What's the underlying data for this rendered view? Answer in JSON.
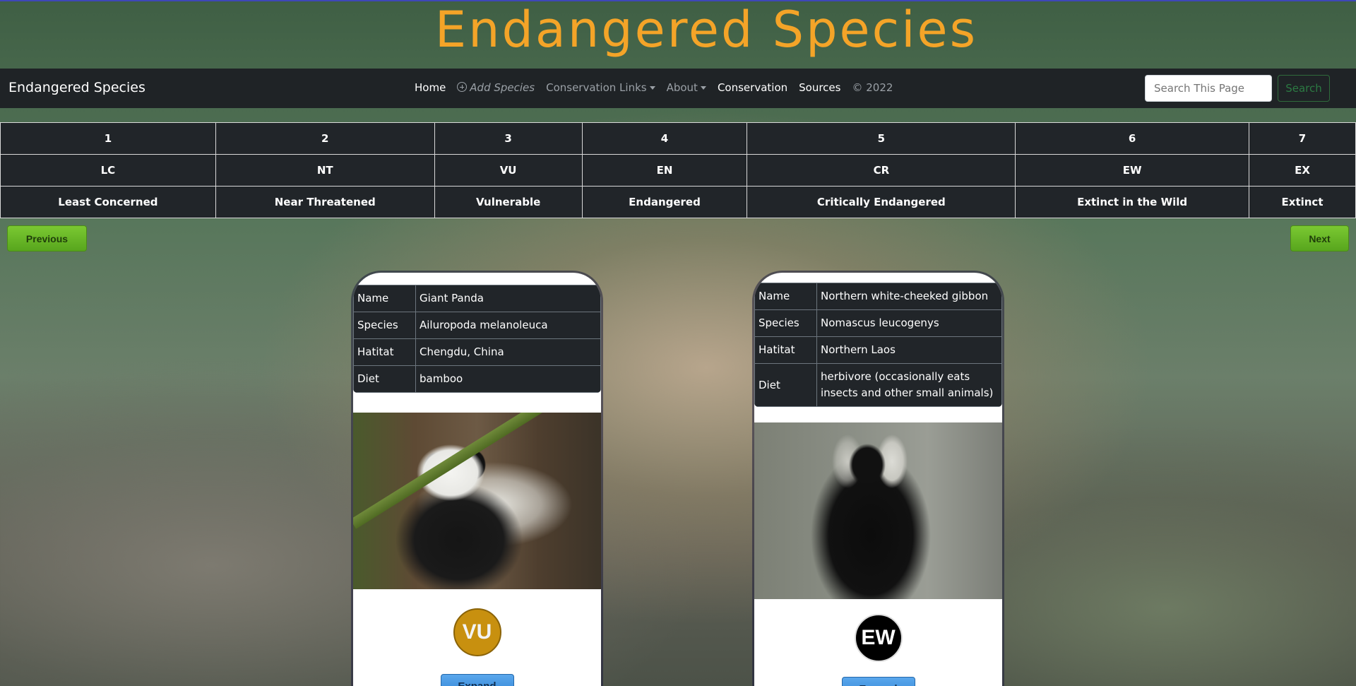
{
  "header": {
    "site_title": "Endangered Species"
  },
  "navbar": {
    "brand": "Endangered Species",
    "links": [
      {
        "label": "Home"
      },
      {
        "label": "Add Species",
        "icon": "plus-circle-icon"
      },
      {
        "label": "Conservation Links",
        "dropdown": true
      },
      {
        "label": "About",
        "dropdown": true
      },
      {
        "label": "Conservation"
      },
      {
        "label": "Sources"
      },
      {
        "label": "© 2022"
      }
    ],
    "search_placeholder": "Search This Page",
    "search_button": "Search"
  },
  "status_table": {
    "numbers": [
      "1",
      "2",
      "3",
      "4",
      "5",
      "6",
      "7"
    ],
    "codes": [
      "LC",
      "NT",
      "VU",
      "EN",
      "CR",
      "EW",
      "EX"
    ],
    "names": [
      "Least Concerned",
      "Near Threatened",
      "Vulnerable",
      "Endangered",
      "Critically Endangered",
      "Extinct in the Wild",
      "Extinct"
    ]
  },
  "pager": {
    "previous": "Previous",
    "next": "Next"
  },
  "cards": [
    {
      "rows": [
        {
          "key": "Name",
          "value": "Giant Panda"
        },
        {
          "key": "Species",
          "value": "Ailuropoda melanoleuca"
        },
        {
          "key": "Hatitat",
          "value": "Chengdu, China"
        },
        {
          "key": "Diet",
          "value": "bamboo"
        }
      ],
      "status_code": "VU",
      "status_color": "#c8900f",
      "expand_label": "Expand"
    },
    {
      "rows": [
        {
          "key": "Name",
          "value": "Northern white-cheeked gibbon"
        },
        {
          "key": "Species",
          "value": "Nomascus leucogenys"
        },
        {
          "key": "Hatitat",
          "value": "Northern Laos"
        },
        {
          "key": "Diet",
          "value": "herbivore (occasionally eats insects and other small animals)"
        }
      ],
      "status_code": "EW",
      "status_color": "#000000",
      "expand_label": "Expand"
    }
  ],
  "colors": {
    "title": "#f4a428",
    "navbar": "#1f2326",
    "next_button": "#58a61d",
    "expand_button": "#2f82d4"
  }
}
